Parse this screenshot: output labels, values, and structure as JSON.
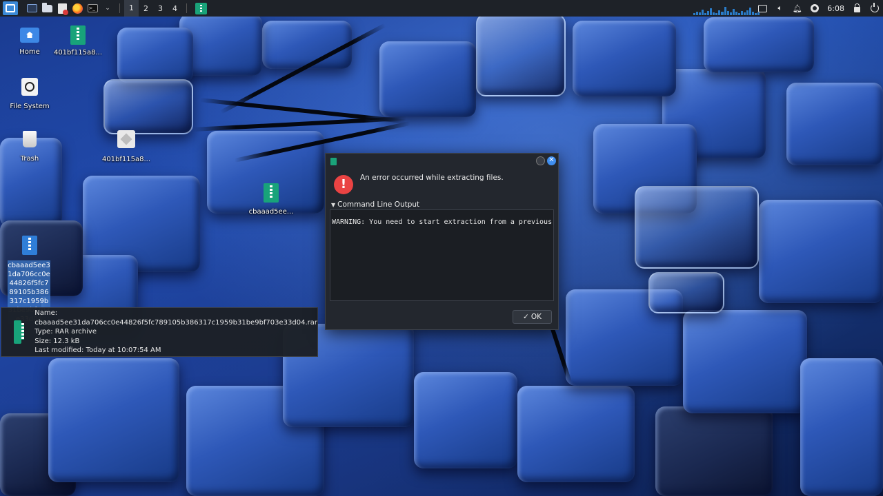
{
  "panel": {
    "workspaces": [
      "1",
      "2",
      "3",
      "4"
    ],
    "active_workspace": "1",
    "clock": "6:08",
    "launchers": [
      "menu-icon",
      "terminal-icon",
      "file-manager-icon",
      "text-editor-icon",
      "firefox-icon",
      "shell-icon"
    ],
    "tray": [
      "display-icon",
      "volume-icon",
      "notification-bell-icon",
      "status-icon",
      "lock-icon",
      "power-icon"
    ]
  },
  "desktop": {
    "icons": [
      {
        "label": "Home"
      },
      {
        "label": "401bf115a8..."
      },
      {
        "label": "File System"
      },
      {
        "label": "Trash"
      },
      {
        "label": "401bf115a8..."
      },
      {
        "label": "cbaaad5ee..."
      }
    ],
    "selected_icon_label": "cbaaad5ee31da706cc0e44826f5fc789105b386317c1959b31be9bf703e33d04"
  },
  "tooltip": {
    "name": "Name: cbaaad5ee31da706cc0e44826f5fc789105b386317c1959b31be9bf703e33d04.rar",
    "type": "Type: RAR archive",
    "size": "Size: 12.3 kB",
    "modified": "Last modified: Today at 10:07:54 AM"
  },
  "dialog": {
    "message": "An error occurred while extracting files.",
    "expander_label": "Command Line Output",
    "output": "WARNING: You need to start extraction from a previous",
    "ok_label": "OK",
    "close_glyph": "✕",
    "error_glyph": "!"
  },
  "colors": {
    "panel_bg": "#1e2228",
    "dialog_bg": "#23272e",
    "error_red": "#ea4343",
    "accent_blue": "#3f8ef0",
    "archive_green": "#18a37a"
  }
}
